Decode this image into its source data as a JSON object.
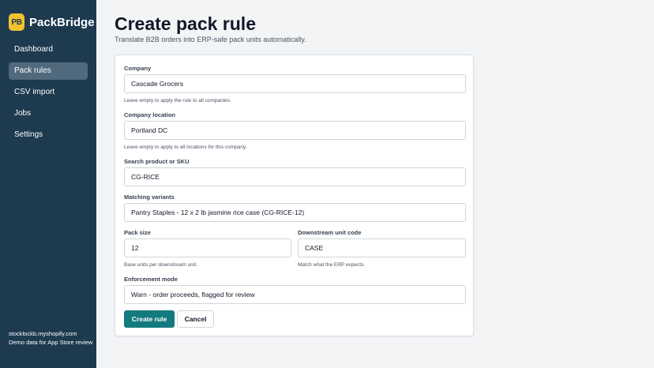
{
  "brand": {
    "logo_text": "PB",
    "name": "PackBridge",
    "accent": "#f2c230"
  },
  "sidebar": {
    "background": "#1d3a4f",
    "items": [
      {
        "label": "Dashboard",
        "active": false
      },
      {
        "label": "Pack rules",
        "active": true
      },
      {
        "label": "CSV import",
        "active": false
      },
      {
        "label": "Jobs",
        "active": false
      },
      {
        "label": "Settings",
        "active": false
      }
    ],
    "footer": {
      "shop": "stocklockb.myshopify.com",
      "note": "Demo data for App Store review"
    }
  },
  "header": {
    "title": "Create pack rule",
    "subtitle": "Translate B2B orders into ERP-safe pack units automatically."
  },
  "form": {
    "company": {
      "label": "Company",
      "value": "Cascade Grocers",
      "help": "Leave empty to apply the rule to all companies."
    },
    "location": {
      "label": "Company location",
      "value": "Portland DC",
      "help": "Leave empty to apply to all locations for this company."
    },
    "search": {
      "label": "Search product or SKU",
      "value": "CG-RICE"
    },
    "variants": {
      "label": "Matching variants",
      "value": "Pantry Staples - 12 x 2 lb jasmine rice case (CG-RICE-12)"
    },
    "pack_size": {
      "label": "Pack size",
      "value": "12",
      "help": "Base units per downstream unit."
    },
    "unit_code": {
      "label": "Downstream unit code",
      "value": "CASE",
      "help": "Match what the ERP expects."
    },
    "enforcement": {
      "label": "Enforcement mode",
      "value": "Warn - order proceeds, flagged for review"
    },
    "buttons": {
      "create": "Create rule",
      "cancel": "Cancel"
    },
    "primary_color": "#137a7f"
  }
}
